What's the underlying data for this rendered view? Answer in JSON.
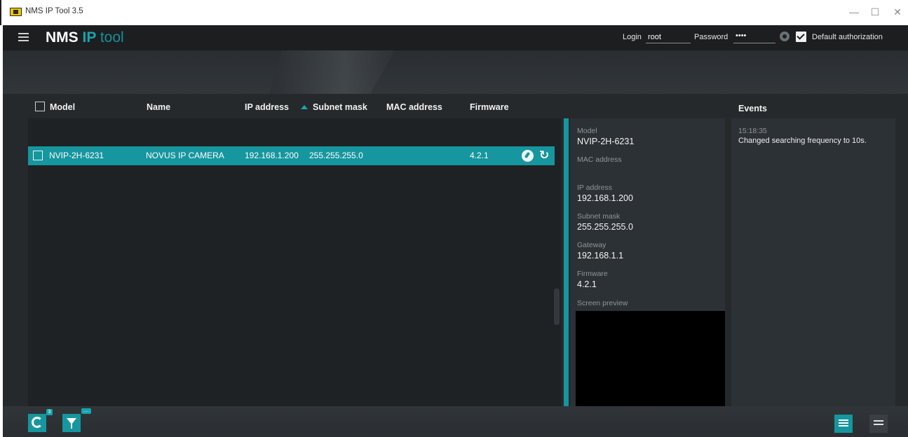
{
  "window": {
    "title": "NMS IP Tool 3.5",
    "minimize": "—",
    "maximize": "☐",
    "close": "✕"
  },
  "header": {
    "brand_part1": "NMS",
    "brand_part2": "IP",
    "brand_part3": "tool",
    "login_label": "Login",
    "login_value": "root",
    "password_label": "Password",
    "password_value": "••••",
    "default_auth_label": "Default authorization"
  },
  "table": {
    "columns": [
      "Model",
      "Name",
      "IP address",
      "Subnet mask",
      "MAC address",
      "Firmware"
    ],
    "rows": [
      {
        "model": "NVIP-2H-6231",
        "name": "NOVUS IP CAMERA",
        "ip": "192.168.1.200",
        "subnet": "255.255.255.0",
        "mac": "",
        "firmware": "4.2.1",
        "reset_icon_glyph": "↻"
      }
    ]
  },
  "details": {
    "model_label": "Model",
    "model_value": "NVIP-2H-6231",
    "mac_label": "MAC address",
    "mac_value": "",
    "ip_label": "IP address",
    "ip_value": "192.168.1.200",
    "subnet_label": "Subnet mask",
    "subnet_value": "255.255.255.0",
    "gateway_label": "Gateway",
    "gateway_value": "192.168.1.1",
    "firmware_label": "Firmware",
    "firmware_value": "4.2.1",
    "preview_label": "Screen preview"
  },
  "events": {
    "title": "Events",
    "items": [
      {
        "time": "15:18:35",
        "message": "Changed searching frequency to 10s."
      }
    ]
  },
  "footer": {
    "refresh_badge": "3",
    "filter_badge": "....",
    "icons": [
      "refresh-icon",
      "filter-icon",
      "event-log-icon",
      "settings-sliders-icon"
    ]
  },
  "colors": {
    "accent": "#16969e",
    "brand_teal": "#19a5ae",
    "background": "#25292c",
    "panel": "#2c3135"
  }
}
